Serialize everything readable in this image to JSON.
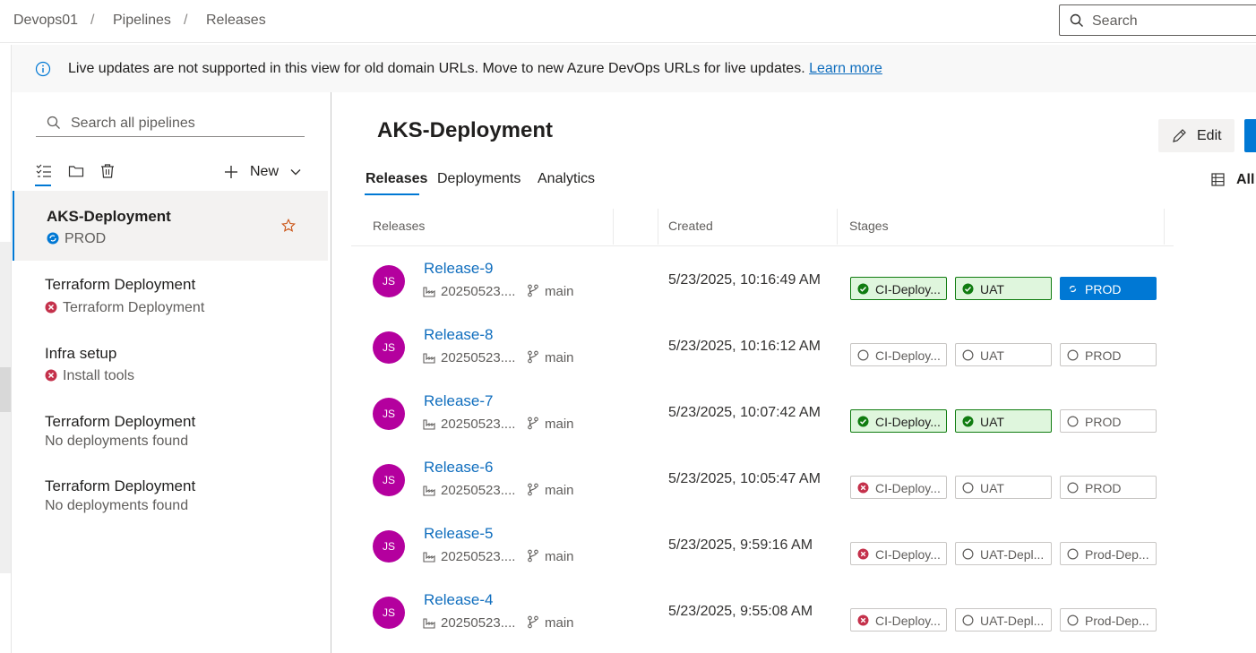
{
  "breadcrumb": {
    "items": [
      "Devops01",
      "Pipelines",
      "Releases"
    ],
    "separator": "/"
  },
  "header_search": {
    "placeholder": "Search"
  },
  "banner": {
    "message": "Live updates are not supported in this view for old domain URLs. Move to new Azure DevOps URLs for live updates.",
    "link": "Learn more"
  },
  "sidebar": {
    "search_placeholder": "Search all pipelines",
    "new_label": "New",
    "pipelines": [
      {
        "name": "AKS-Deployment",
        "status": "PROD",
        "status_icon": "in-progress-icon",
        "selected": true,
        "favorite": true
      },
      {
        "name": "Terraform Deployment",
        "status": "Terraform Deployment",
        "status_icon": "failed-icon"
      },
      {
        "name": "Infra setup",
        "status": "Install tools",
        "status_icon": "failed-icon"
      },
      {
        "name": "Terraform Deployment",
        "status": "No deployments found",
        "status_icon": ""
      },
      {
        "name": "Terraform Deployment",
        "status": "No deployments found",
        "status_icon": ""
      }
    ]
  },
  "main": {
    "title": "AKS-Deployment",
    "edit_label": "Edit",
    "tabs": [
      "Releases",
      "Deployments",
      "Analytics"
    ],
    "active_tab": "Releases",
    "all_label": "All",
    "columns": [
      "Releases",
      "Created",
      "Stages"
    ],
    "releases": [
      {
        "initials": "JS",
        "name": "Release-9",
        "build": "20250523....",
        "branch": "main",
        "created": "5/23/2025, 10:16:49 AM",
        "stages": [
          {
            "label": "CI-Deploy...",
            "status": "succeeded"
          },
          {
            "label": "UAT",
            "status": "succeeded"
          },
          {
            "label": "PROD",
            "status": "inprogress"
          }
        ]
      },
      {
        "initials": "JS",
        "name": "Release-8",
        "build": "20250523....",
        "branch": "main",
        "created": "5/23/2025, 10:16:12 AM",
        "stages": [
          {
            "label": "CI-Deploy...",
            "status": "notstarted"
          },
          {
            "label": "UAT",
            "status": "notstarted"
          },
          {
            "label": "PROD",
            "status": "notstarted"
          }
        ]
      },
      {
        "initials": "JS",
        "name": "Release-7",
        "build": "20250523....",
        "branch": "main",
        "created": "5/23/2025, 10:07:42 AM",
        "stages": [
          {
            "label": "CI-Deploy...",
            "status": "succeeded"
          },
          {
            "label": "UAT",
            "status": "succeeded"
          },
          {
            "label": "PROD",
            "status": "notstarted"
          }
        ]
      },
      {
        "initials": "JS",
        "name": "Release-6",
        "build": "20250523....",
        "branch": "main",
        "created": "5/23/2025, 10:05:47 AM",
        "stages": [
          {
            "label": "CI-Deploy...",
            "status": "failed"
          },
          {
            "label": "UAT",
            "status": "notstarted"
          },
          {
            "label": "PROD",
            "status": "notstarted"
          }
        ]
      },
      {
        "initials": "JS",
        "name": "Release-5",
        "build": "20250523....",
        "branch": "main",
        "created": "5/23/2025, 9:59:16 AM",
        "stages": [
          {
            "label": "CI-Deploy...",
            "status": "failed"
          },
          {
            "label": "UAT-Depl...",
            "status": "notstarted"
          },
          {
            "label": "Prod-Dep...",
            "status": "notstarted"
          }
        ]
      },
      {
        "initials": "JS",
        "name": "Release-4",
        "build": "20250523....",
        "branch": "main",
        "created": "5/23/2025, 9:55:08 AM",
        "stages": [
          {
            "label": "CI-Deploy...",
            "status": "failed"
          },
          {
            "label": "UAT-Depl...",
            "status": "notstarted"
          },
          {
            "label": "Prod-Dep...",
            "status": "notstarted"
          }
        ]
      }
    ]
  },
  "colors": {
    "accent": "#0078d4",
    "link": "#106ebe",
    "avatar": "#b4009e",
    "succeeded": "#107c10",
    "failed": "#c4314b"
  }
}
